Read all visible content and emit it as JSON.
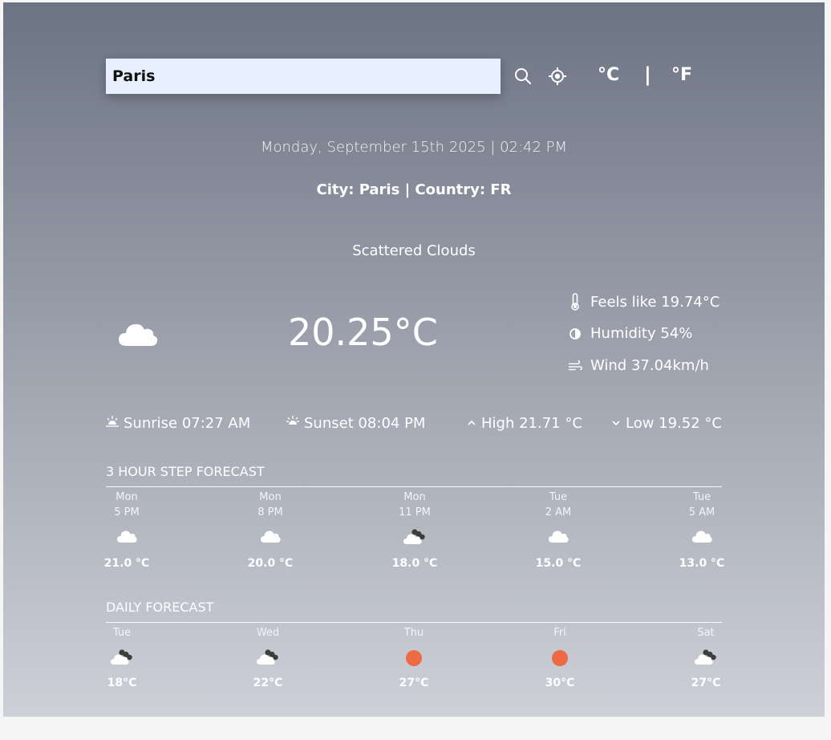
{
  "search": {
    "value": "Paris"
  },
  "units": {
    "celsius": "°C",
    "separator": "|",
    "fahrenheit": "°F"
  },
  "datetime": "Monday, September 15th 2025 | 02:42 PM",
  "location": "City: Paris | Country: FR",
  "description": "Scattered Clouds",
  "temperature": "20.25°C",
  "stats": {
    "feels_like": "Feels like 19.74°C",
    "humidity": "Humidity 54%",
    "wind": "Wind 37.04km/h"
  },
  "sun": {
    "sunrise": "Sunrise 07:27 AM",
    "sunset": "Sunset 08:04 PM",
    "high": "High 21.71 °C",
    "low": "Low 19.52 °C"
  },
  "hourly": {
    "title": "3 HOUR STEP FORECAST",
    "items": [
      {
        "day": "Mon",
        "time": "5 PM",
        "icon": "cloud-icon",
        "temp": "21.0 °C"
      },
      {
        "day": "Mon",
        "time": "8 PM",
        "icon": "cloud-icon",
        "temp": "20.0 °C"
      },
      {
        "day": "Mon",
        "time": "11 PM",
        "icon": "broken-clouds-icon",
        "temp": "18.0 °C"
      },
      {
        "day": "Tue",
        "time": "2 AM",
        "icon": "cloud-icon",
        "temp": "15.0 °C"
      },
      {
        "day": "Tue",
        "time": "5 AM",
        "icon": "cloud-icon",
        "temp": "13.0 °C"
      }
    ]
  },
  "daily": {
    "title": "DAILY FORECAST",
    "items": [
      {
        "day": "Tue",
        "icon": "broken-clouds-icon",
        "temp": "18°C"
      },
      {
        "day": "Wed",
        "icon": "broken-clouds-icon",
        "temp": "22°C"
      },
      {
        "day": "Thu",
        "icon": "sun-icon",
        "temp": "27°C"
      },
      {
        "day": "Fri",
        "icon": "sun-icon",
        "temp": "30°C"
      },
      {
        "day": "Sat",
        "icon": "broken-clouds-icon",
        "temp": "27°C"
      }
    ]
  },
  "colors": {
    "sun": "#ee6a45",
    "search_bg": "#e8effd"
  }
}
